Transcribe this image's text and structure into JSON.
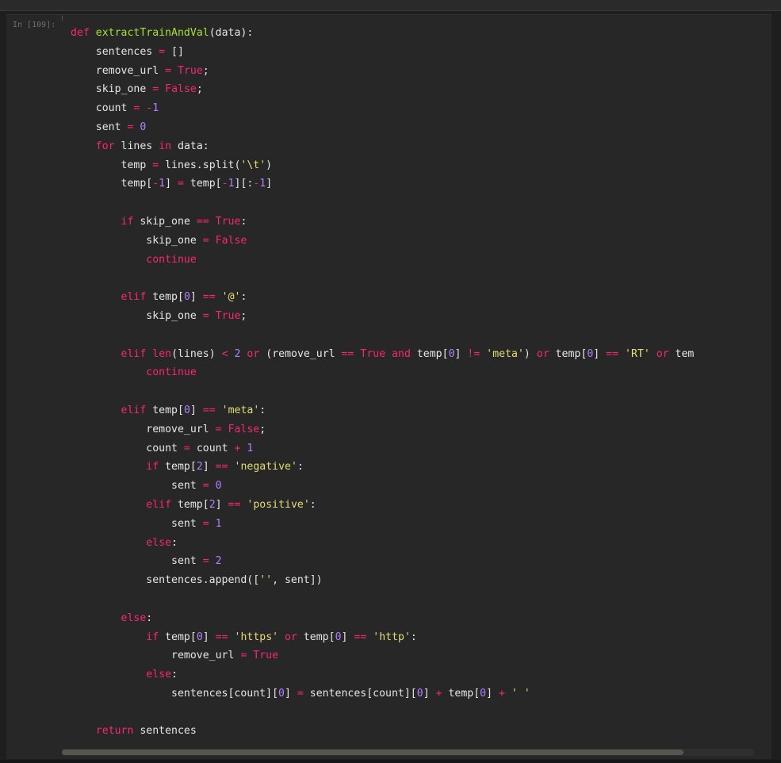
{
  "cell": {
    "prompt": "In [109]:",
    "lines": [
      "def extractTrainAndVal(data):",
      "    sentences = []",
      "    remove_url = True;",
      "    skip_one = False;",
      "    count = -1",
      "    sent = 0",
      "    for lines in data:",
      "        temp = lines.split('\\t')",
      "        temp[-1] = temp[-1][:-1]",
      "",
      "        if skip_one == True:",
      "            skip_one = False",
      "            continue",
      "",
      "        elif temp[0] == '@':",
      "            skip_one = True;",
      "",
      "        elif len(lines) < 2 or (remove_url == True and temp[0] != 'meta') or temp[0] == 'RT' or tem",
      "            continue",
      "",
      "        elif temp[0] == 'meta':",
      "            remove_url = False;",
      "            count = count + 1",
      "            if temp[2] == 'negative':",
      "                sent = 0",
      "            elif temp[2] == 'positive':",
      "                sent = 1",
      "            else:",
      "                sent = 2",
      "            sentences.append(['', sent])",
      "",
      "        else:",
      "            if temp[0] == 'https' or temp[0] == 'http':",
      "                remove_url = True",
      "            else:",
      "                sentences[count][0] = sentences[count][0] + temp[0] + ' '",
      "",
      "    return sentences"
    ]
  },
  "colors": {
    "keyword": "#f92672",
    "function": "#a6e22e",
    "string": "#e6db74",
    "number": "#ae81ff",
    "text": "#e6e6e6",
    "background": "#272727"
  }
}
